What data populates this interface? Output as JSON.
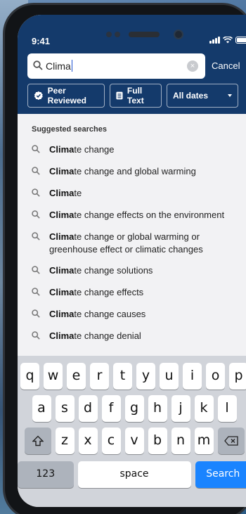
{
  "status_bar": {
    "time": "9:41"
  },
  "search": {
    "query": "Clima",
    "cancel_label": "Cancel"
  },
  "filters": [
    {
      "label": "Peer Reviewed",
      "icon": "verified-badge-icon"
    },
    {
      "label": "Full Text",
      "icon": "document-icon"
    },
    {
      "label": "All dates",
      "icon": "chevron-down-icon"
    }
  ],
  "suggestions": {
    "title": "Suggested searches",
    "items": [
      {
        "bold": "Clima",
        "rest": "te change"
      },
      {
        "bold": "Clima",
        "rest": "te change and global warming"
      },
      {
        "bold": "Clima",
        "rest": "te"
      },
      {
        "bold": "Clima",
        "rest": "te change effects on the environment"
      },
      {
        "bold": "Clima",
        "rest": "te change or global warming or greenhouse effect or climatic changes"
      },
      {
        "bold": "Clima",
        "rest": "te change solutions"
      },
      {
        "bold": "Clima",
        "rest": "te change effects"
      },
      {
        "bold": "Clima",
        "rest": "te change causes"
      },
      {
        "bold": "Clima",
        "rest": "te change denial"
      }
    ]
  },
  "keyboard": {
    "row1": [
      "q",
      "w",
      "e",
      "r",
      "t",
      "y",
      "u",
      "i",
      "o",
      "p"
    ],
    "row2": [
      "a",
      "s",
      "d",
      "f",
      "g",
      "h",
      "j",
      "k",
      "l"
    ],
    "row3": [
      "z",
      "x",
      "c",
      "v",
      "b",
      "n",
      "m"
    ],
    "num_label": "123",
    "space_label": "space",
    "search_label": "Search"
  },
  "colors": {
    "header": "#143a6b",
    "accent": "#1a84ff"
  }
}
